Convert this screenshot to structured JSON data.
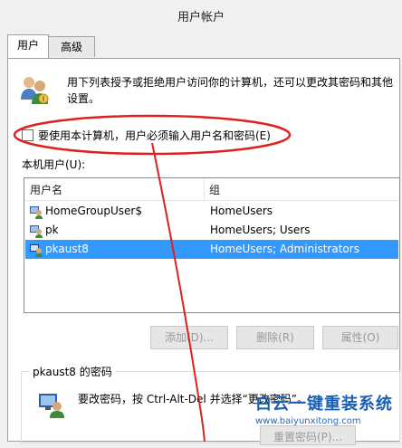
{
  "window": {
    "title": "用户帐户"
  },
  "tabs": [
    {
      "label": "用户"
    },
    {
      "label": "高级"
    }
  ],
  "intro_text": "用下列表授予或拒绝用户访问你的计算机，还可以更改其密码和其他设置。",
  "require_password": {
    "label": "要使用本计算机，用户必须输入用户名和密码(E)",
    "checked": false
  },
  "users_list": {
    "label": "本机用户(U):",
    "columns": [
      "用户名",
      "组"
    ],
    "rows": [
      {
        "name": "HomeGroupUser$",
        "group": "HomeUsers",
        "selected": false
      },
      {
        "name": "pk",
        "group": "HomeUsers; Users",
        "selected": false
      },
      {
        "name": "pkaust8",
        "group": "HomeUsers; Administrators",
        "selected": true
      }
    ]
  },
  "buttons": {
    "add": "添加(D)...",
    "remove": "删除(R)",
    "properties": "属性(O)"
  },
  "password_group": {
    "title": "pkaust8 的密码",
    "text": "要改密码，按 Ctrl-Alt-Del 并选择“更改密码”。",
    "reset_button": "重置密码(P)..."
  },
  "watermark": {
    "title": "白云一键重装系统",
    "url": "www.baiyunxitong.com"
  },
  "colors": {
    "selection": "#3399ff",
    "annotation_red": "#e0201e",
    "watermark_blue": "#1a5fb4"
  }
}
